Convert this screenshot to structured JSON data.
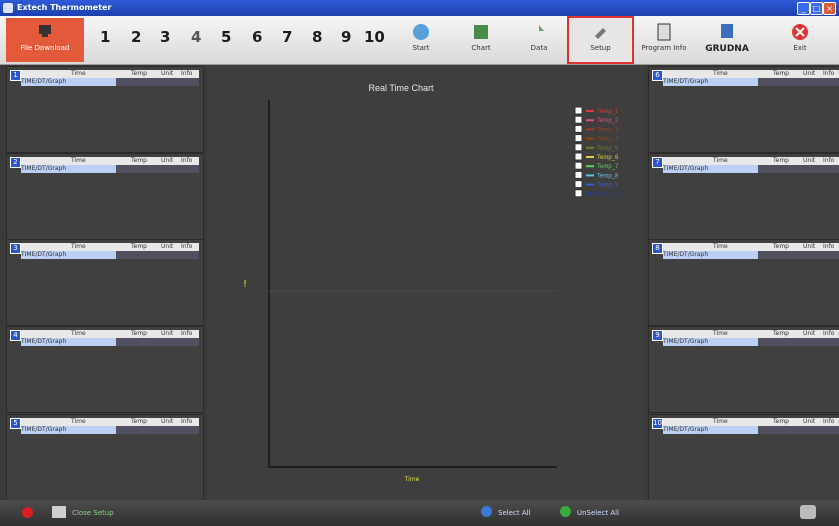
{
  "window": {
    "title": "Extech Thermometer"
  },
  "toolbar": {
    "left_button_label": "File Download",
    "numbers": [
      "1",
      "2",
      "3",
      "4",
      "5",
      "6",
      "7",
      "8",
      "9",
      "10"
    ],
    "start": "Start",
    "chart": "Chart",
    "data": "Data",
    "setup": "Setup",
    "program_info": "Program Info",
    "logo_text": "GRUDNA",
    "exit": "Exit"
  },
  "panels": {
    "header": {
      "time": "Time",
      "temp": "Temp",
      "unit": "Unit",
      "info": "Info"
    },
    "row_text": "TIME/DT/Graph",
    "left_ids": [
      "1",
      "2",
      "3",
      "4",
      "5"
    ],
    "right_ids": [
      "6",
      "7",
      "8",
      "9",
      "10"
    ]
  },
  "chart_data": {
    "type": "line",
    "title": "Real Time Chart",
    "xlabel": "Time",
    "ylabel": "",
    "grid": false,
    "legend_position": "top-right",
    "series": [
      {
        "name": "Temp_1",
        "color": "#e23a3a"
      },
      {
        "name": "Temp_2",
        "color": "#e0507a"
      },
      {
        "name": "Temp_3",
        "color": "#a04020"
      },
      {
        "name": "Temp_4",
        "color": "#8b4513"
      },
      {
        "name": "Temp_5",
        "color": "#6f7d2f"
      },
      {
        "name": "Temp_6",
        "color": "#e0d040"
      },
      {
        "name": "Temp_7",
        "color": "#60d060"
      },
      {
        "name": "Temp_8",
        "color": "#60c0e0"
      },
      {
        "name": "Temp_9",
        "color": "#3a5ad0"
      },
      {
        "name": "Temp_10",
        "color": "#2a3a90"
      }
    ]
  },
  "status": {
    "close_setup": "Close Setup",
    "select_all": "Select All",
    "unselect_all": "UnSelect All"
  },
  "colors": {
    "accent": "#e03030",
    "panel_bg": "#404040",
    "chart_bg": "#3e3e3e"
  }
}
